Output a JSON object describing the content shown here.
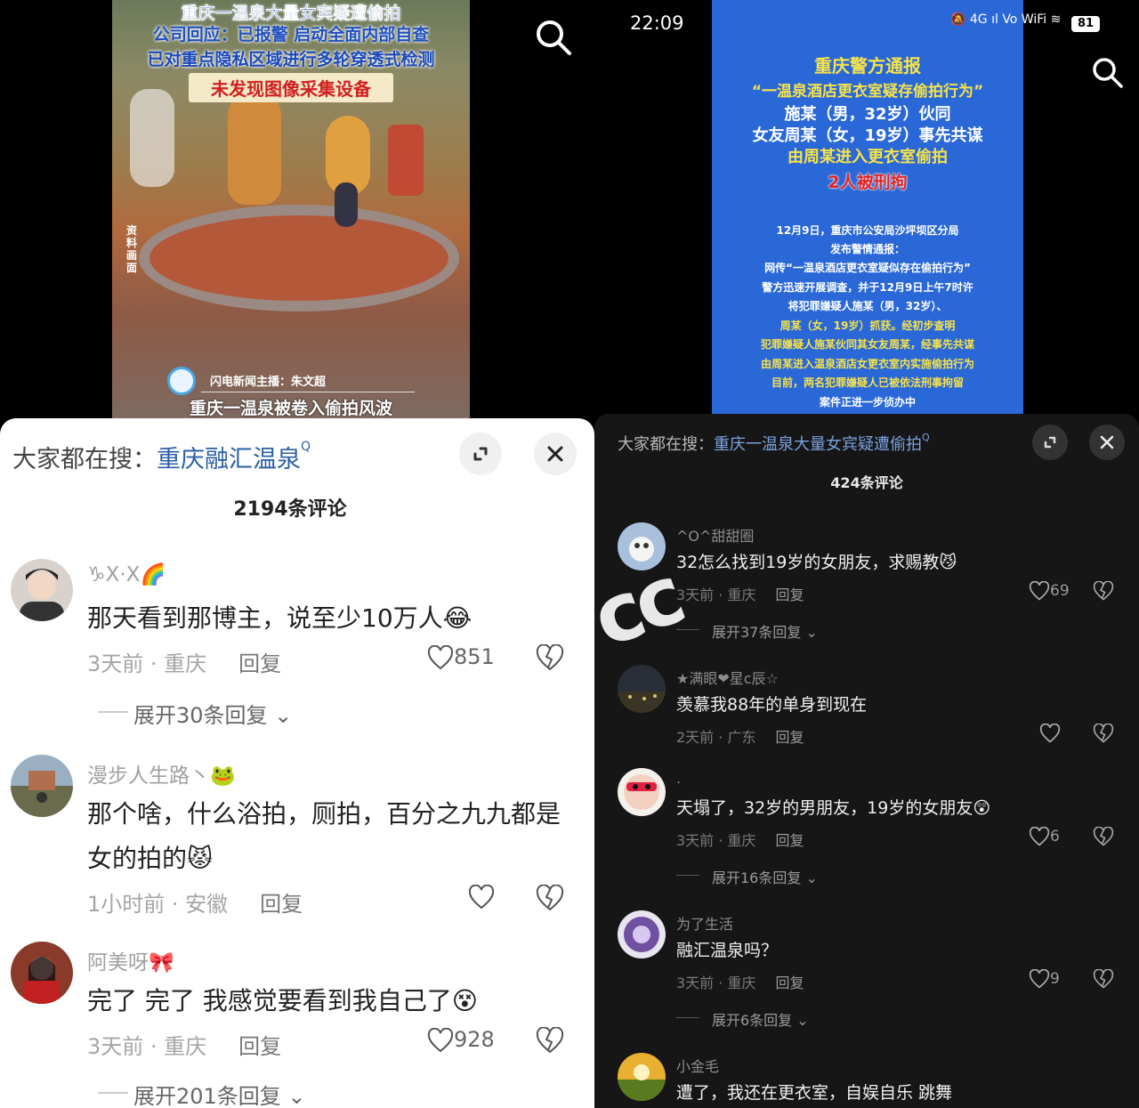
{
  "left": {
    "video": {
      "headline_1": "重庆一温泉大量女宾疑遭偷拍",
      "headline_2": "公司回应：已报警 启动全面内部自查",
      "headline_3": "已对重点隐私区域进行多轮穿透式检测",
      "headline_4": "未发现图像采集设备",
      "side_label": "资料画面",
      "anchor": "闪电新闻主播：朱文超",
      "caption": "重庆一温泉被卷入偷拍风波"
    },
    "search_prefix": "大家都在搜：",
    "search_query": "重庆融汇温泉",
    "search_sup": "Q",
    "comment_count": "2194条评论",
    "comments": [
      {
        "name": "♑X·X🌈",
        "text": "那天看到那博主，说至少10万人😂",
        "meta": "3天前 · 重庆",
        "reply": "回复",
        "likes": "851",
        "expand": "展开30条回复 ⌄"
      },
      {
        "name": "漫步人生路丶🐸",
        "text": "那个啥，什么浴拍，厕拍，百分之九九都是女的拍的😾",
        "meta": "1小时前 · 安徽",
        "reply": "回复",
        "likes": "",
        "expand": ""
      },
      {
        "name": "阿美呀🎀",
        "text": "完了 完了 我感觉要看到我自己了😵",
        "meta": "3天前 · 重庆",
        "reply": "回复",
        "likes": "928",
        "expand": "展开201条回复 ⌄"
      }
    ]
  },
  "right": {
    "status": {
      "time": "22:09",
      "signal": "🔕 4G ıl Vo WiFi ≋",
      "battery": "81"
    },
    "notice": {
      "title": "重庆警方通报",
      "line2": "“一温泉酒店更衣室疑存偷拍行为”",
      "line3": "施某（男，32岁）伙同",
      "line4": "女友周某（女，19岁）事先共谋",
      "line5": "由周某进入更衣室偷拍",
      "line6": "2人被刑拘",
      "p1": "12月9日，重庆市公安局沙坪坝区分局",
      "p2": "发布警情通报：",
      "p3": "网传“一温泉酒店更衣室疑似存在偷拍行为”",
      "p4": "警方迅速开展调查，并于12月9日上午7时许",
      "p5": "将犯罪嫌疑人施某（男，32岁）、",
      "p6": "周某（女，19岁）抓获。经初步查明",
      "p7": "犯罪嫌疑人施某伙同其女友周某，经事先共谋",
      "p8": "由周某进入温泉酒店女更衣室内实施偷拍行为",
      "p9": "目前，两名犯罪嫌疑人已被依法刑事拘留",
      "p10": "案件正进一步侦办中"
    },
    "search_prefix": "大家都在搜：",
    "search_query": "重庆一温泉大量女宾疑遭偷拍",
    "search_sup": "Q",
    "comment_count": "424条评论",
    "comments": [
      {
        "name": "^O^甜甜圈",
        "text": "32怎么找到19岁的女朋友，求赐教😼",
        "meta": "3天前 · 重庆",
        "reply": "回复",
        "likes": "69",
        "expand": "展开37条回复 ⌄"
      },
      {
        "name": "★满眼❤星c辰☆",
        "text": "羡慕我88年的单身到现在",
        "meta": "2天前 · 广东",
        "reply": "回复",
        "likes": "",
        "expand": ""
      },
      {
        "name": ".",
        "text": "天塌了，32岁的男朋友，19岁的女朋友😲",
        "meta": "3天前 · 重庆",
        "reply": "回复",
        "likes": "6",
        "expand": "展开16条回复 ⌄"
      },
      {
        "name": "为了生活",
        "text": "融汇温泉吗？",
        "meta": "3天前 · 重庆",
        "reply": "回复",
        "likes": "9",
        "expand": "展开6条回复 ⌄"
      },
      {
        "name": "小金毛",
        "text": "遭了，我还在更衣室，自娱自乐 跳舞",
        "meta": "",
        "reply": "",
        "likes": "",
        "expand": ""
      }
    ]
  },
  "watermark": "cc"
}
